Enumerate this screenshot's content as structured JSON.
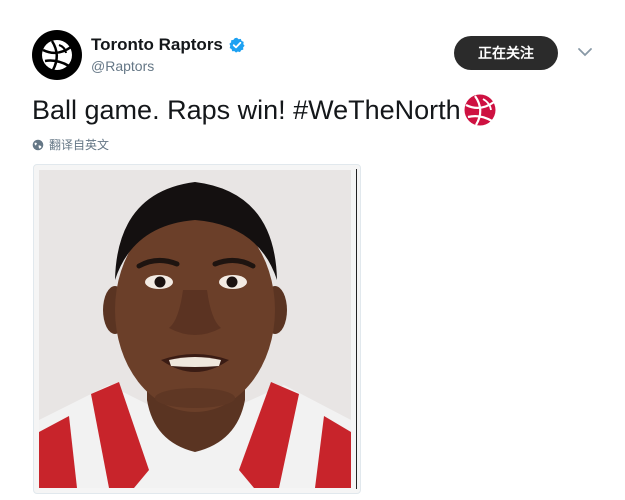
{
  "author": {
    "display_name": "Toronto Raptors",
    "handle": "@Raptors",
    "verified": true,
    "avatar_icon": "raptors-ball-logo-icon"
  },
  "follow_button": {
    "label": "正在关注"
  },
  "tweet": {
    "text": "Ball game. Raps win! #WeTheNorth",
    "emoji": "raptors-basketball-icon"
  },
  "translate": {
    "label": "翻译自英文",
    "icon": "globe-icon"
  },
  "media": {
    "type": "photo"
  },
  "colors": {
    "follow_bg": "#2b2b2b",
    "verified_blue": "#1da1f2",
    "raptors_red": "#ce1141",
    "secondary_text": "#657786"
  }
}
